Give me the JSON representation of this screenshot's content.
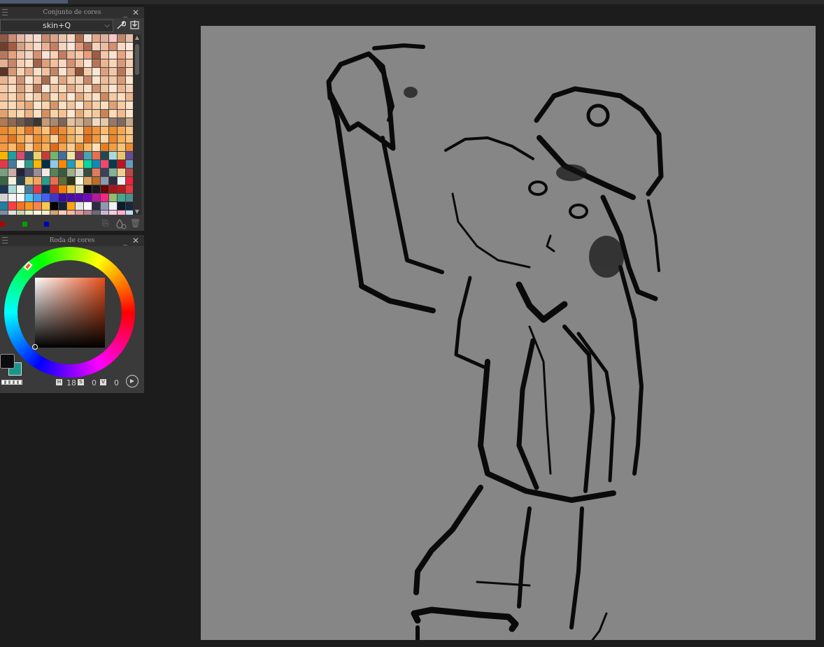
{
  "palette_panel": {
    "title": "Conjunto de cores",
    "set_name": "skin+Q",
    "minimize": "_",
    "close": "✕",
    "icons": [
      "wrench-icon",
      "import-icon",
      "add-color-icon",
      "add-drop-icon",
      "trash-icon"
    ],
    "rgb_dots": [
      "#b00000",
      "#00a000",
      "#0000c0"
    ]
  },
  "swatches": [
    "#8d5a4a",
    "#c88d72",
    "#e3b7a4",
    "#f0d1c1",
    "#f3dbcf",
    "#c98b6e",
    "#d9a48a",
    "#e8c4ad",
    "#f5d7c4",
    "#b06e52",
    "#f3e0d3",
    "#e6a689",
    "#dcb29e",
    "#f9c6c7",
    "#c0866c",
    "#e5bfaa",
    "#f1cbb5",
    "#6e3f2e",
    "#a55d42",
    "#d2a084",
    "#f2c5a6",
    "#f8dcc9",
    "#eab295",
    "#c77f62",
    "#f3d4c0",
    "#fae5d6",
    "#e19a7b",
    "#a96b55",
    "#f6d2bd",
    "#ecbba1",
    "#d48e70",
    "#f5d9c3",
    "#ffead9",
    "#c29277",
    "#b67860",
    "#e8a17e",
    "#f0c3aa",
    "#f4d7c5",
    "#d9906f",
    "#f7e2d3",
    "#fbd0b5",
    "#c57b5c",
    "#efb897",
    "#f8c9ad",
    "#ea9e79",
    "#9d5c45",
    "#f6c5a5",
    "#fde1cd",
    "#e8a37e",
    "#fbdcc5",
    "#c4846a",
    "#e6b193",
    "#c68769",
    "#f6cdb2",
    "#fde0c7",
    "#a26449",
    "#e39f7a",
    "#f3bf9d",
    "#fbd9c0",
    "#d49070",
    "#f2c29f",
    "#fce6d6",
    "#b77659",
    "#eeb591",
    "#f8d5bb",
    "#da9877",
    "#f7cfaf",
    "#e9b08e",
    "#5a3526",
    "#d59976",
    "#f8d2b3",
    "#e5a984",
    "#fae0c9",
    "#f2c39f",
    "#c58565",
    "#fbe3cc",
    "#e7ac88",
    "#8f5339",
    "#f5ccaa",
    "#fde7d3",
    "#dda07b",
    "#f4c8a7",
    "#b8775a",
    "#fad7bb",
    "#f1bd98",
    "#e9b590",
    "#f7d3b5",
    "#cf9271",
    "#fde8d5",
    "#f1c4a2",
    "#a96c50",
    "#fbdfc5",
    "#e0a580",
    "#f8cfaf",
    "#f5d5b9",
    "#c88969",
    "#fbe4ce",
    "#edbb97",
    "#f3c9a7",
    "#d89a75",
    "#fde6d0",
    "#ecb693",
    "#f4caa8",
    "#fbdcc0",
    "#dca17b",
    "#f8d6b8",
    "#b87a5b",
    "#fde9d7",
    "#efc19e",
    "#f9dbbf",
    "#e4aa85",
    "#f6d0b0",
    "#fbe0c6",
    "#d19371",
    "#f1c3a0",
    "#fde5cf",
    "#eab48f",
    "#f7d4b6",
    "#fad9bc",
    "#f3c49c",
    "#f9d8b8",
    "#e8ac82",
    "#fde4c9",
    "#f6cda8",
    "#d89a6e",
    "#fbdfc2",
    "#f0bb92",
    "#fde8d3",
    "#e3a57a",
    "#f8d2ae",
    "#fce1c6",
    "#c98a60",
    "#f5c9a3",
    "#fbdcbd",
    "#eeb68c",
    "#fee9d5",
    "#f7cfa9",
    "#fbdab7",
    "#f1be94",
    "#e6a67a",
    "#fde5cb",
    "#f9d4af",
    "#d59566",
    "#fbe0c3",
    "#f4c59d",
    "#fee8d1",
    "#ebaf84",
    "#f8d1aa",
    "#fcdebf",
    "#dfa074",
    "#f6cba3",
    "#fde3c7",
    "#f0ba8f",
    "#e3a071",
    "#f7cca2",
    "#fbd9b4",
    "#eeb387",
    "#fce2c3",
    "#d49061",
    "#f9d2aa",
    "#f3c195",
    "#fde6cb",
    "#e8a979",
    "#fad6b0",
    "#f5c89d",
    "#c98456",
    "#fbdbb8",
    "#f1bb8c",
    "#fee5c9",
    "#f7cfa6",
    "#b07a55",
    "#8c6a52",
    "#6e5a4c",
    "#534743",
    "#3c3533",
    "#c49a78",
    "#a68a73",
    "#7a6659",
    "#e3c3a2",
    "#d4b190",
    "#b5957a",
    "#f1dac0",
    "#e6c9a9",
    "#96796a",
    "#7f6a5f",
    "#c9a98b",
    "#ae9079",
    "#e8892e",
    "#f09a3c",
    "#f5b05a",
    "#e2782a",
    "#f3a24b",
    "#fbc27c",
    "#de6f24",
    "#eb8e35",
    "#f7b565",
    "#fdd29a",
    "#e47b27",
    "#f0963a",
    "#f9bd73",
    "#ec8d2f",
    "#f5a853",
    "#fcc788",
    "#e68330",
    "#f0923a",
    "#e17520",
    "#f7a84d",
    "#fcc182",
    "#eb8a2d",
    "#f4a046",
    "#fbd49e",
    "#e37c25",
    "#efb061",
    "#f9c98b",
    "#de6c1d",
    "#f2983f",
    "#fdd7a5",
    "#e98629",
    "#f6ae58",
    "#fbc47f",
    "#e27826",
    "#f29942",
    "#fab868",
    "#e58329",
    "#fcd09a",
    "#ee8f35",
    "#f7b15e",
    "#dd6d1c",
    "#f4a44c",
    "#fbcc93",
    "#e98a30",
    "#f8b764",
    "#fde0b9",
    "#e47e22",
    "#f09d45",
    "#f9c17c",
    "#ec8b32",
    "#f5a853",
    "#f4b400",
    "#1ba1a2",
    "#d94a6b",
    "#2d4f6c",
    "#e8d36a",
    "#c53b3b",
    "#75b36b",
    "#3f6fa5",
    "#f2e3a4",
    "#8a3a5e",
    "#48a4b3",
    "#e76f51",
    "#264653",
    "#a8dadc",
    "#e9c46a",
    "#6a4c93",
    "#f4a261",
    "#e63946",
    "#457b9d",
    "#f1faee",
    "#2a9d8f",
    "#ffb703",
    "#023047",
    "#8ecae6",
    "#fb8500",
    "#219ebc",
    "#ffd166",
    "#06d6a0",
    "#118ab2",
    "#ef476f",
    "#073b4c",
    "#c1121f",
    "#669bbc",
    "#fdf0d5",
    "#7a9e7e",
    "#c9ada7",
    "#22223b",
    "#4a4e69",
    "#9a8c98",
    "#f2e9e4",
    "#588157",
    "#3a5a40",
    "#a3b18a",
    "#dad7cd",
    "#344e41",
    "#e07a5f",
    "#3d405b",
    "#81b29a",
    "#f2cc8f",
    "#bc4749",
    "#6a994e",
    "#386641",
    "#f4f1de",
    "#264653",
    "#e9c46a",
    "#f4a261",
    "#2a9d8f",
    "#e76f51",
    "#606c38",
    "#283618",
    "#fefae0",
    "#dda15e",
    "#bc6c25",
    "#8d99ae",
    "#2b2d42",
    "#edf2f4",
    "#ef233c",
    "#d90429",
    "#1d3557",
    "#a8dadc",
    "#f1faee",
    "#457b9d",
    "#e63946",
    "#003049",
    "#d62828",
    "#f77f00",
    "#fcbf49",
    "#eae2b7",
    "#0b090a",
    "#161a1d",
    "#660708",
    "#a4161a",
    "#ba181b",
    "#e5383b",
    "#b1a7a6",
    "#d3d3d3",
    "#f5f3f4",
    "#ffffff",
    "#4cc9f0",
    "#4895ef",
    "#4361ee",
    "#3f37c9",
    "#3a0ca3",
    "#480ca8",
    "#560bad",
    "#7209b7",
    "#b5179e",
    "#f72585",
    "#90be6d",
    "#43aa8b",
    "#4d908e",
    "#577590",
    "#277da1",
    "#f94144",
    "#f3722c",
    "#f8961e",
    "#f9844a",
    "#f9c74f",
    "#000000",
    "#14213d",
    "#fca311",
    "#e5e5e5",
    "#ffffff",
    "#2b2d42",
    "#8d99ae",
    "#edf2f4",
    "#0d1b2a",
    "#1b263b",
    "#415a77",
    "#778da9",
    "#e0e1dd",
    "#ccd5ae",
    "#e9edc9",
    "#fefae0",
    "#faedcd",
    "#d4a373",
    "#ffcdb2",
    "#ffb4a2",
    "#e5989b",
    "#b5838d",
    "#6d6875",
    "#cdb4db",
    "#ffc8dd",
    "#ffafcc",
    "#bde0fe",
    "#a2d2ff",
    "#0077b6",
    "#00b4d8",
    "#90e0ef",
    "#caf0f8",
    "#03045e",
    "#f08080",
    "#f4978e",
    "#f8ad9d",
    "#fbc4ab",
    "#ffdab9",
    "#2ec4b6",
    "#cbf3f0",
    "#ffbf69",
    "#ff9f1c",
    "#1982c4",
    "#8ac926",
    "#ffca3a"
  ],
  "color_wheel_panel": {
    "title": "Roda de cores",
    "minimize": "_",
    "close": "✕",
    "main_color": "#0b0b10",
    "sub_color": "#19968c",
    "h_label": "H",
    "h_value": "18",
    "s_label": "S",
    "s_value": "0",
    "v_label": "V",
    "v_value": "0"
  },
  "canvas": {
    "background": "#868686"
  }
}
